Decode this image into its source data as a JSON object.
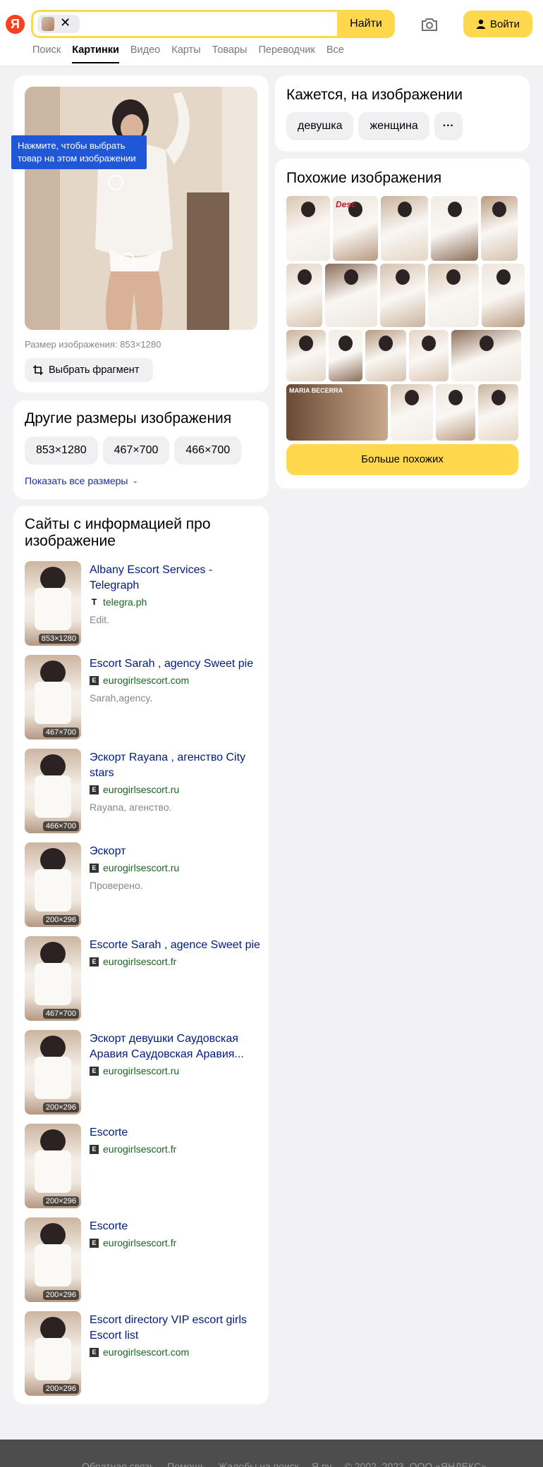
{
  "header": {
    "logo": "Я",
    "search_button": "Найти",
    "login_button": "Войти",
    "tabs": [
      "Поиск",
      "Картинки",
      "Видео",
      "Карты",
      "Товары",
      "Переводчик",
      "Все"
    ]
  },
  "image_card": {
    "tooltip": "Нажмите, чтобы выбрать товар на этом изображении",
    "size_caption": "Размер изображения: 853×1280",
    "select_fragment": "Выбрать фрагмент"
  },
  "sizes_card": {
    "title": "Другие размеры изображения",
    "sizes": [
      "853×1280",
      "467×700",
      "466×700"
    ],
    "show_all": "Показать все размеры"
  },
  "sites_card": {
    "title": "Сайты с информацией про изображение",
    "items": [
      {
        "title": "Albany Escort Services - Telegraph",
        "domain": "telegra.ph",
        "fav": "T",
        "snippet": "Edit.",
        "dim": "853×1280"
      },
      {
        "title": "Escort Sarah , agency Sweet pie",
        "domain": "eurogirlsescort.com",
        "fav": "E",
        "snippet": "Sarah,agency.",
        "dim": "467×700"
      },
      {
        "title": "Эскорт Rayana , агенство City stars",
        "domain": "eurogirlsescort.ru",
        "fav": "E",
        "snippet": "Rayana, агенство.",
        "dim": "466×700"
      },
      {
        "title": "Эскорт",
        "domain": "eurogirlsescort.ru",
        "fav": "E",
        "snippet": "Проверено.",
        "dim": "200×296"
      },
      {
        "title": "Escorte Sarah , agence Sweet pie",
        "domain": "eurogirlsescort.fr",
        "fav": "E",
        "snippet": "",
        "dim": "467×700"
      },
      {
        "title": "Эскорт девушки Саудовская Аравия Саудовская Аравия...",
        "domain": "eurogirlsescort.ru",
        "fav": "E",
        "snippet": "",
        "dim": "200×296"
      },
      {
        "title": "Escorte",
        "domain": "eurogirlsescort.fr",
        "fav": "E",
        "snippet": "",
        "dim": "200×296"
      },
      {
        "title": "Escorte",
        "domain": "eurogirlsescort.fr",
        "fav": "E",
        "snippet": "",
        "dim": "200×296"
      },
      {
        "title": "Escort directory VIP escort girls Escort list",
        "domain": "eurogirlsescort.com",
        "fav": "E",
        "snippet": "",
        "dim": "200×296"
      }
    ]
  },
  "tags_card": {
    "title": "Кажется, на изображении",
    "tags": [
      "девушка",
      "женщина"
    ],
    "more": "···"
  },
  "similar_card": {
    "title": "Похожие изображения",
    "overlay_text_1": "Desc",
    "overlay_text_2": "MARIA BECERRA",
    "more_button": "Больше похожих"
  },
  "footer": {
    "links": [
      "Обратная связь",
      "Помощь",
      "Жалобы на поиск",
      "Я.ру",
      "© 2002–2023, ООО «ЯНДЕКС»"
    ]
  }
}
